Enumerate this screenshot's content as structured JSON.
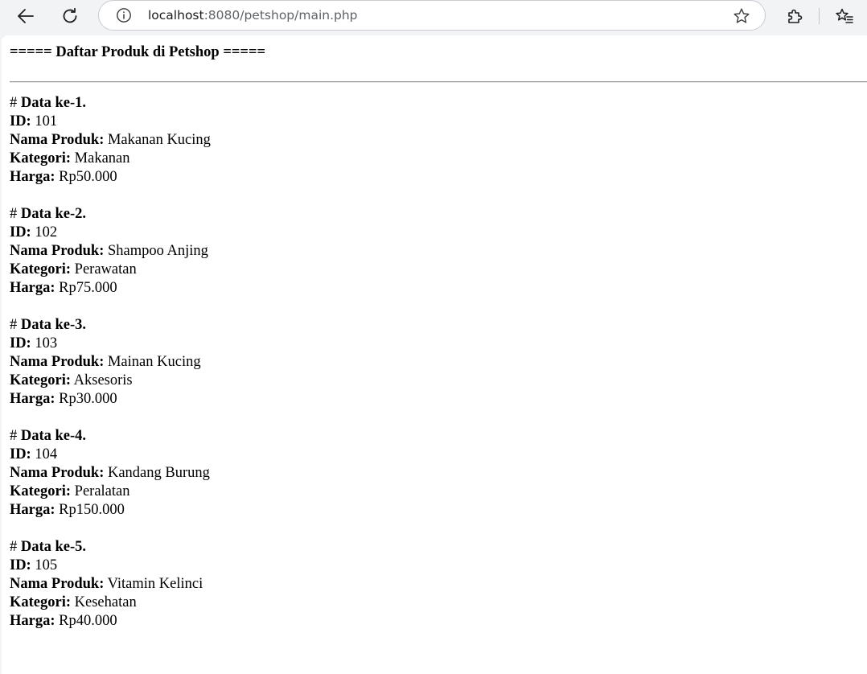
{
  "browser": {
    "url_host": "localhost",
    "url_rest": ":8080/petshop/main.php"
  },
  "page": {
    "heading": "===== Daftar Produk di Petshop =====",
    "labels": {
      "id": "ID:",
      "nama": "Nama Produk:",
      "kategori": "Kategori:",
      "harga": "Harga:"
    },
    "records": [
      {
        "hash": "#",
        "title": "Data ke-1.",
        "id": "101",
        "nama": "Makanan Kucing",
        "kategori": "Makanan",
        "harga": "Rp50.000"
      },
      {
        "hash": "#",
        "title": "Data ke-2.",
        "id": "102",
        "nama": "Shampoo Anjing",
        "kategori": "Perawatan",
        "harga": "Rp75.000"
      },
      {
        "hash": "#",
        "title": "Data ke-3.",
        "id": "103",
        "nama": "Mainan Kucing",
        "kategori": "Aksesoris",
        "harga": "Rp30.000"
      },
      {
        "hash": "#",
        "title": "Data ke-4.",
        "id": "104",
        "nama": "Kandang Burung",
        "kategori": "Peralatan",
        "harga": "Rp150.000"
      },
      {
        "hash": "#",
        "title": "Data ke-5.",
        "id": "105",
        "nama": "Vitamin Kelinci",
        "kategori": "Kesehatan",
        "harga": "Rp40.000"
      }
    ]
  },
  "icons": {
    "back": "back-arrow-icon",
    "reload": "reload-icon",
    "info": "info-icon",
    "star": "star-icon",
    "extensions": "puzzle-icon",
    "favorites": "favorites-icon"
  }
}
